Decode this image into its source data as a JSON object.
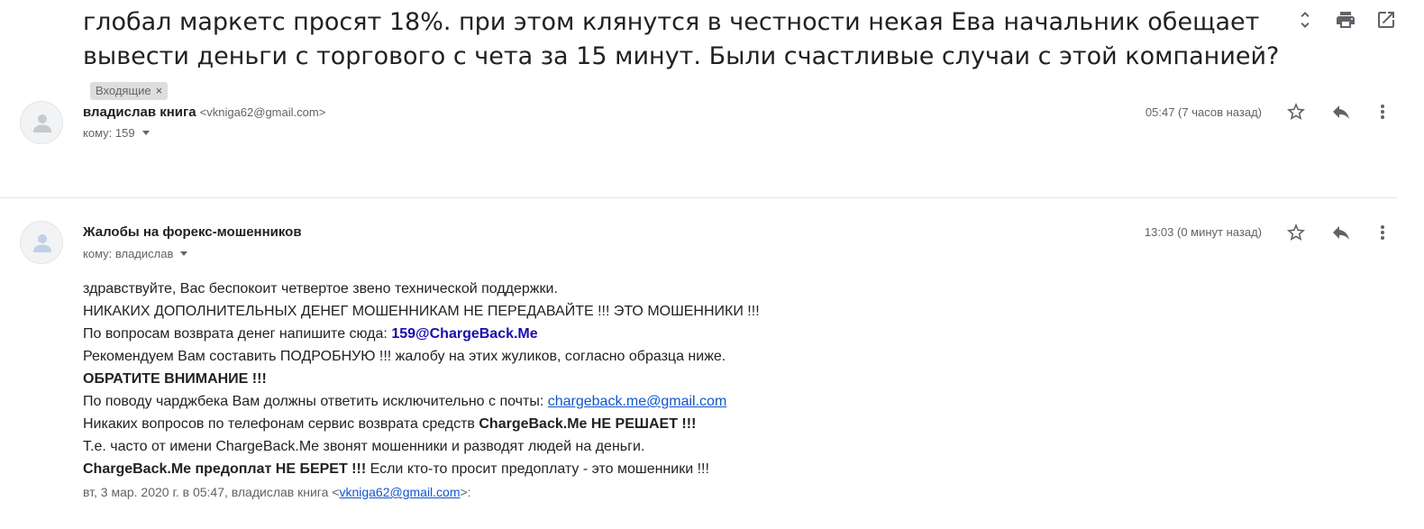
{
  "subject": {
    "text": "глобал маркетс просят 18%. при этом клянутся в честности некая Ева начальник обещает вывести деньги с торгового с чета за 15 минут. Были счастливые случаи с этой компанией?",
    "label": "Входящие",
    "label_remove": "×"
  },
  "toolbar": {
    "icons": [
      "expand-collapse-icon",
      "print-icon",
      "open-new-window-icon"
    ]
  },
  "messages": [
    {
      "sender_name": "владислав книга",
      "sender_email": "<vkniga62@gmail.com>",
      "to": "кому: 159",
      "time": "05:47 (7 часов назад)"
    },
    {
      "sender_name": "Жалобы на форекс-мошенников",
      "to": "кому: владислав",
      "time": "13:03 (0 минут назад)",
      "body": {
        "l1": "здравствуйте, Вас беспокоит четвертое звено технической поддержки.",
        "l2": "НИКАКИХ ДОПОЛНИТЕЛЬНЫХ ДЕНЕГ МОШЕННИКАМ НЕ ПЕРЕДАВАЙТЕ !!! ЭТО МОШЕННИКИ !!!",
        "l3_prefix": "По вопросам возврата денег напишите сюда: ",
        "l3_email": "159@ChargeBack.Me",
        "l4": "Рекомендуем Вам составить ПОДРОБНУЮ !!! жалобу на этих жуликов, согласно образца ниже.",
        "l5": "ОБРАТИТЕ ВНИМАНИЕ !!!",
        "l6_prefix": "По поводу чарджбека Вам должны ответить исключительно с почты: ",
        "l6_link": "chargeback.me@gmail.com",
        "l7_prefix": "Никаких вопросов по телефонам сервис возврата средств ",
        "l7_bold": "ChargeBack.Me НЕ РЕШАЕТ !!!",
        "l8": "Т.е. часто от имени ChargeBack.Me звонят мошенники и разводят людей на деньги.",
        "l9_bold": "ChargeBack.Me предоплат НЕ БЕРЕТ !!!",
        "l9_rest": " Если кто-то просит предоплату - это мошенники !!!"
      },
      "quote": {
        "prefix": "вт, 3 мар. 2020 г. в 05:47, владислав книга <",
        "email": "vkniga62@gmail.com",
        "suffix": ">:"
      }
    }
  ]
}
